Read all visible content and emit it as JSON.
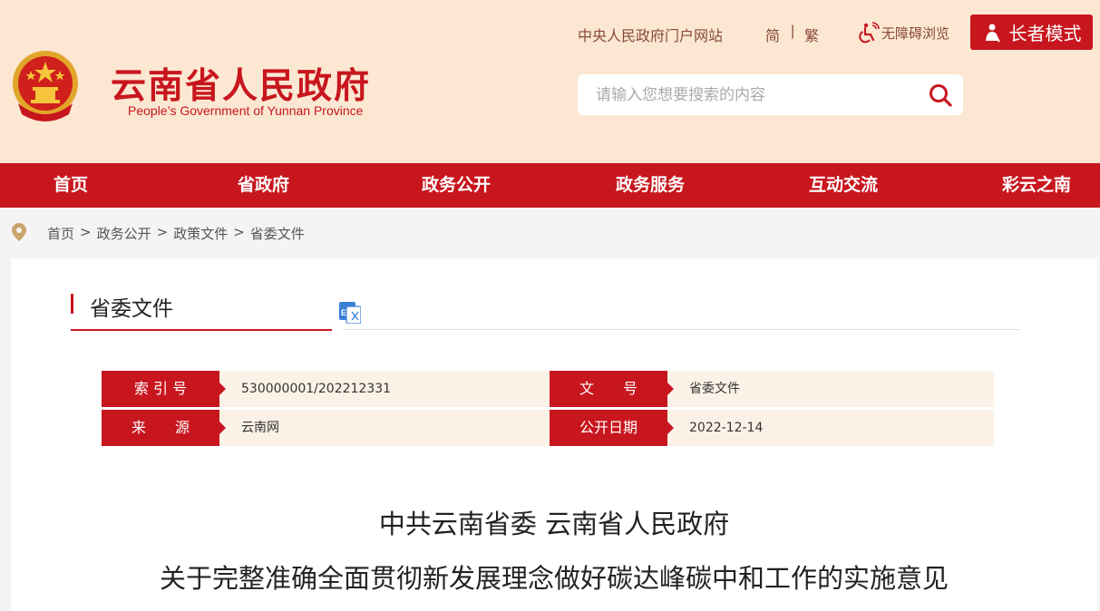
{
  "header": {
    "site_title": "云南省人民政府",
    "site_subtitle": "People’s Government of Yunnan Province",
    "central_gov_link": "中央人民政府门户网站",
    "simplified_label": "简",
    "lang_separator": "|",
    "traditional_label": "繁",
    "accessibility_label": "无障碍浏览",
    "elder_mode_label": "长者模式",
    "search_placeholder": "请输入您想要搜索的内容"
  },
  "nav": {
    "items": [
      "首页",
      "省政府",
      "政务公开",
      "政务服务",
      "互动交流",
      "彩云之南"
    ]
  },
  "breadcrumb": {
    "items": [
      "首页",
      "政务公开",
      "政策文件",
      "省委文件"
    ],
    "separator": ">"
  },
  "section": {
    "title": "省委文件"
  },
  "meta": {
    "index_label": "索 引 号",
    "index_value": "530000001/202212331",
    "doc_no_label": "文　　号",
    "doc_no_value": "省委文件",
    "source_label": "来　　源",
    "source_value": "云南网",
    "date_label": "公开日期",
    "date_value": "2022-12-14"
  },
  "document": {
    "title_line1": "中共云南省委 云南省人民政府",
    "title_line2": "关于完整准确全面贯彻新发展理念做好碳达峰碳中和工作的实施意见"
  },
  "colors": {
    "brand_red": "#c8161e",
    "header_bg": "#fbe7d2",
    "meta_bg": "#fbf1e7"
  },
  "icons": [
    "national-emblem-icon",
    "accessibility-icon",
    "elder-person-icon",
    "search-icon",
    "location-pin-icon",
    "english-translate-icon"
  ]
}
